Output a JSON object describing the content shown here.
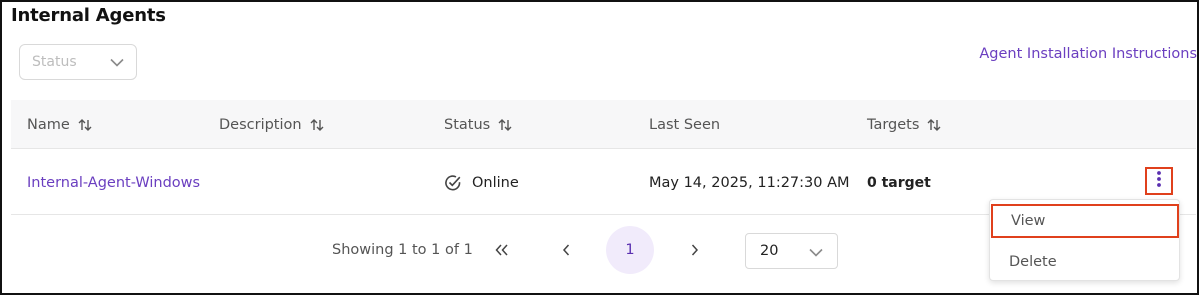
{
  "page": {
    "title": "Internal Agents"
  },
  "filters": {
    "status_placeholder": "Status"
  },
  "links": {
    "install_instructions": "Agent Installation Instructions"
  },
  "table": {
    "columns": [
      {
        "label": "Name",
        "sortable": true
      },
      {
        "label": "Description",
        "sortable": true
      },
      {
        "label": "Status",
        "sortable": true
      },
      {
        "label": "Last Seen",
        "sortable": false
      },
      {
        "label": "Targets",
        "sortable": true
      }
    ],
    "rows": [
      {
        "name": "Internal-Agent-Windows",
        "description": "",
        "status": "Online",
        "last_seen": "May 14, 2025, 11:27:30 AM",
        "targets": "0 target"
      }
    ]
  },
  "pagination": {
    "showing": "Showing 1 to 1 of 1",
    "current_page": "1",
    "page_size": "20"
  },
  "row_menu": {
    "view": "View",
    "delete": "Delete"
  },
  "colors": {
    "accent": "#6b3fc0",
    "highlight": "#e0401c",
    "header_bg": "#f7f7f8"
  }
}
